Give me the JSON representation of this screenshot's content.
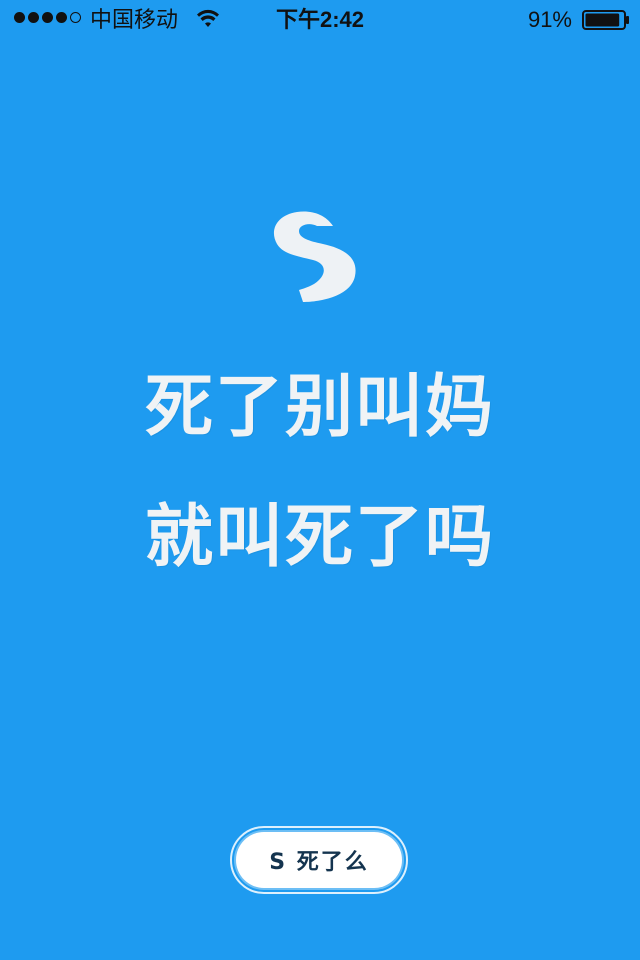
{
  "status_bar": {
    "signal_bars_filled": 4,
    "signal_bars_total": 5,
    "carrier": "中国移动",
    "wifi_icon": "wifi-icon",
    "time": "下午2:42",
    "battery_percent": "91%",
    "battery_level": 0.91,
    "battery_icon": "battery-icon"
  },
  "splash": {
    "logo_icon": "s-logo-icon",
    "line1": "死了别叫妈",
    "line2": "就叫死了吗",
    "button_label": "S 死了么"
  },
  "colors": {
    "background": "#1e9bf0",
    "text_light": "#f0f3f5",
    "button_bg": "#ffffff",
    "button_text": "#14344f"
  }
}
